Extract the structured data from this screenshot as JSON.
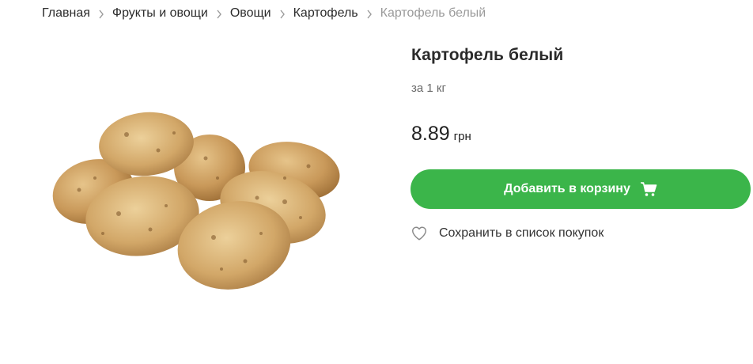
{
  "breadcrumb": {
    "items": [
      {
        "label": "Главная"
      },
      {
        "label": "Фрукты и овощи"
      },
      {
        "label": "Овощи"
      },
      {
        "label": "Картофель"
      }
    ],
    "current": "Картофель белый"
  },
  "product": {
    "title": "Картофель белый",
    "unit": "за 1 кг",
    "price": "8.89",
    "currency": "грн",
    "image_icon": "potatoes-image"
  },
  "actions": {
    "add_to_cart_label": "Добавить в корзину",
    "add_to_cart_icon": "cart-icon",
    "save_label": "Сохранить в список покупок",
    "save_icon": "heart-icon"
  },
  "colors": {
    "accent": "#3bb54a",
    "breadcrumb_current": "#9a9a9a"
  }
}
